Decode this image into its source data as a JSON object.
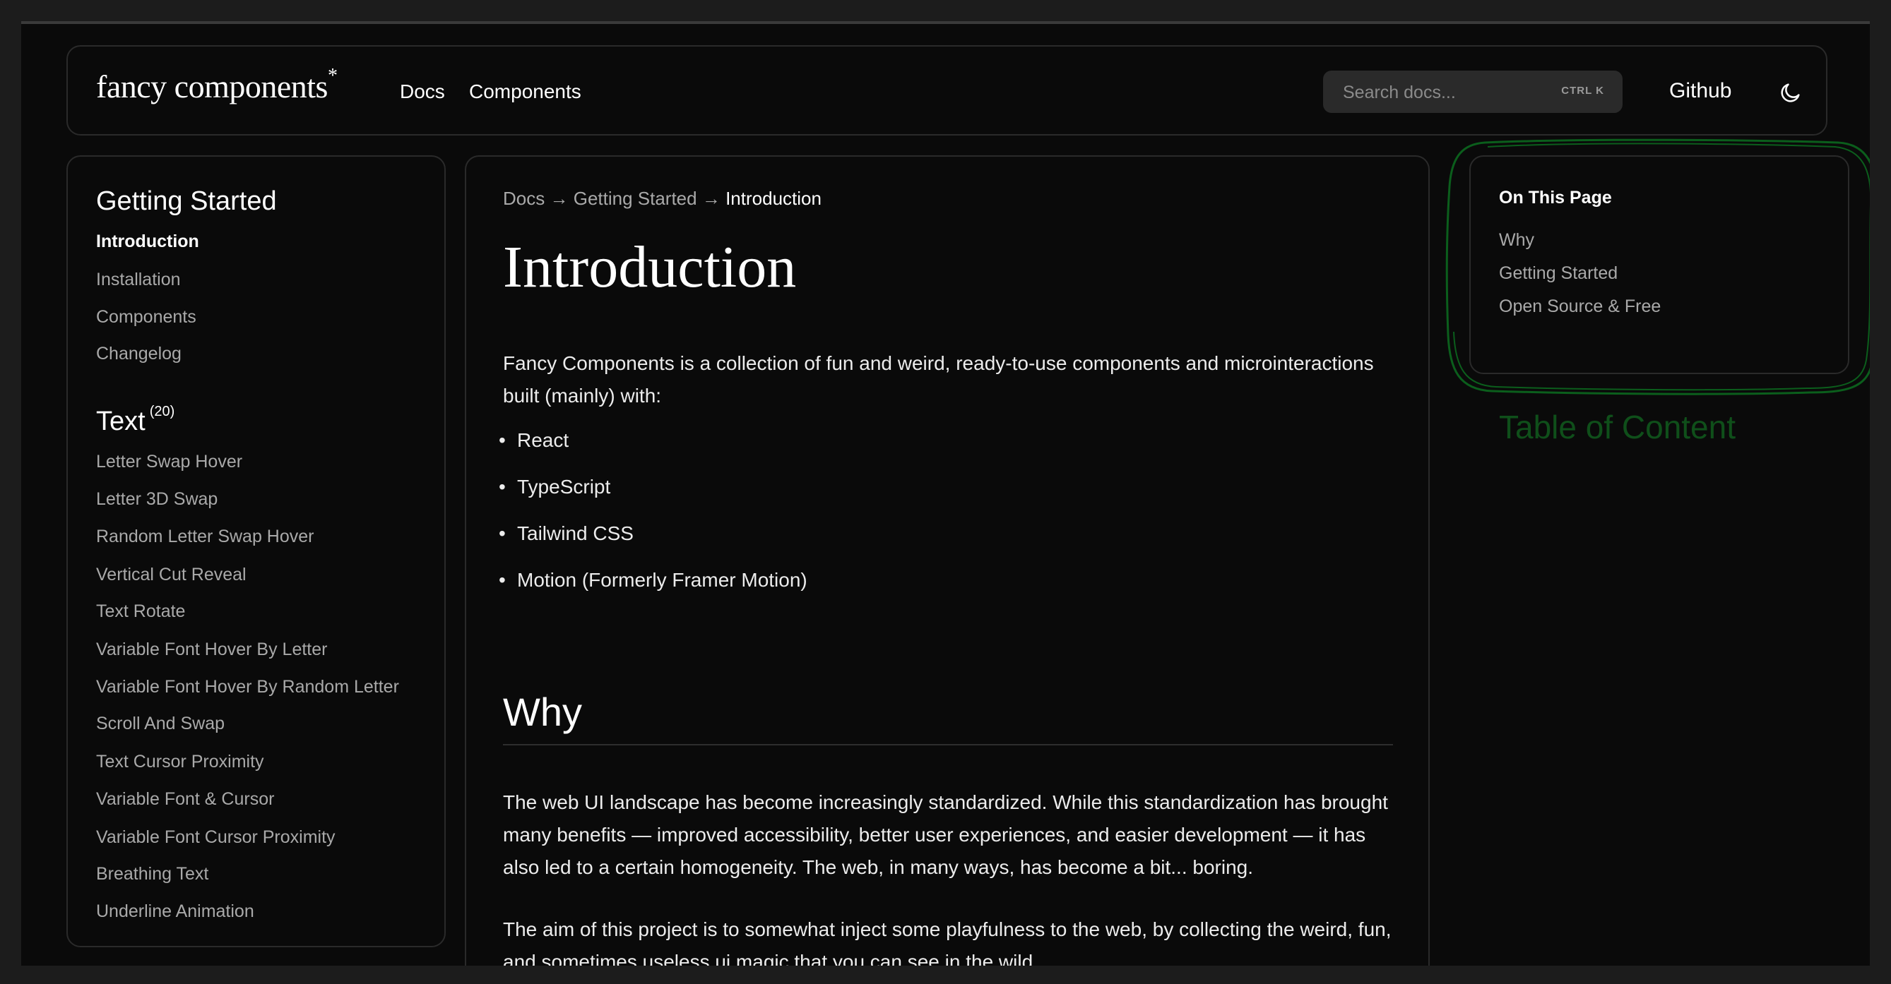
{
  "header": {
    "logo_text": "fancy components",
    "logo_mark": "*",
    "nav": [
      "Docs",
      "Components"
    ],
    "search_placeholder": "Search docs...",
    "search_shortcut": "CTRL K",
    "github_label": "Github",
    "theme_icon": "moon-icon"
  },
  "sidebar": {
    "sections": [
      {
        "title": "Getting Started",
        "count": "",
        "items": [
          "Introduction",
          "Installation",
          "Components",
          "Changelog"
        ],
        "active": "Introduction"
      },
      {
        "title": "Text",
        "count": "(20)",
        "items": [
          "Letter Swap Hover",
          "Letter 3D Swap",
          "Random Letter Swap Hover",
          "Vertical Cut Reveal",
          "Text Rotate",
          "Variable Font Hover By Letter",
          "Variable Font Hover By Random Letter",
          "Scroll And Swap",
          "Text Cursor Proximity",
          "Variable Font & Cursor",
          "Variable Font Cursor Proximity",
          "Breathing Text",
          "Underline Animation"
        ]
      }
    ]
  },
  "main": {
    "breadcrumb": [
      "Docs",
      "Getting Started",
      "Introduction"
    ],
    "breadcrumb_separator": "→",
    "title": "Introduction",
    "intro": "Fancy Components is a collection of fun and weird, ready-to-use components and microinteractions built (mainly) with:",
    "tech": [
      "React",
      "TypeScript",
      "Tailwind CSS",
      "Motion (Formerly Framer Motion)"
    ],
    "why_title": "Why",
    "why_p1": "The web UI landscape has become increasingly standardized. While this standardization has brought many benefits — improved accessibility, better user experiences, and easier development — it has also led to a certain homogeneity. The web, in many ways, has become a bit... boring.",
    "why_p2": "The aim of this project is to somewhat inject some playfulness to the web, by collecting the weird, fun, and sometimes useless ui magic that you can see in the wild."
  },
  "toc": {
    "title": "On This Page",
    "items": [
      "Why",
      "Getting Started",
      "Open Source & Free"
    ],
    "annotation": "Table of Content",
    "annotation_color": "#0f4f1a",
    "outline_color": "#0b5e1c"
  }
}
